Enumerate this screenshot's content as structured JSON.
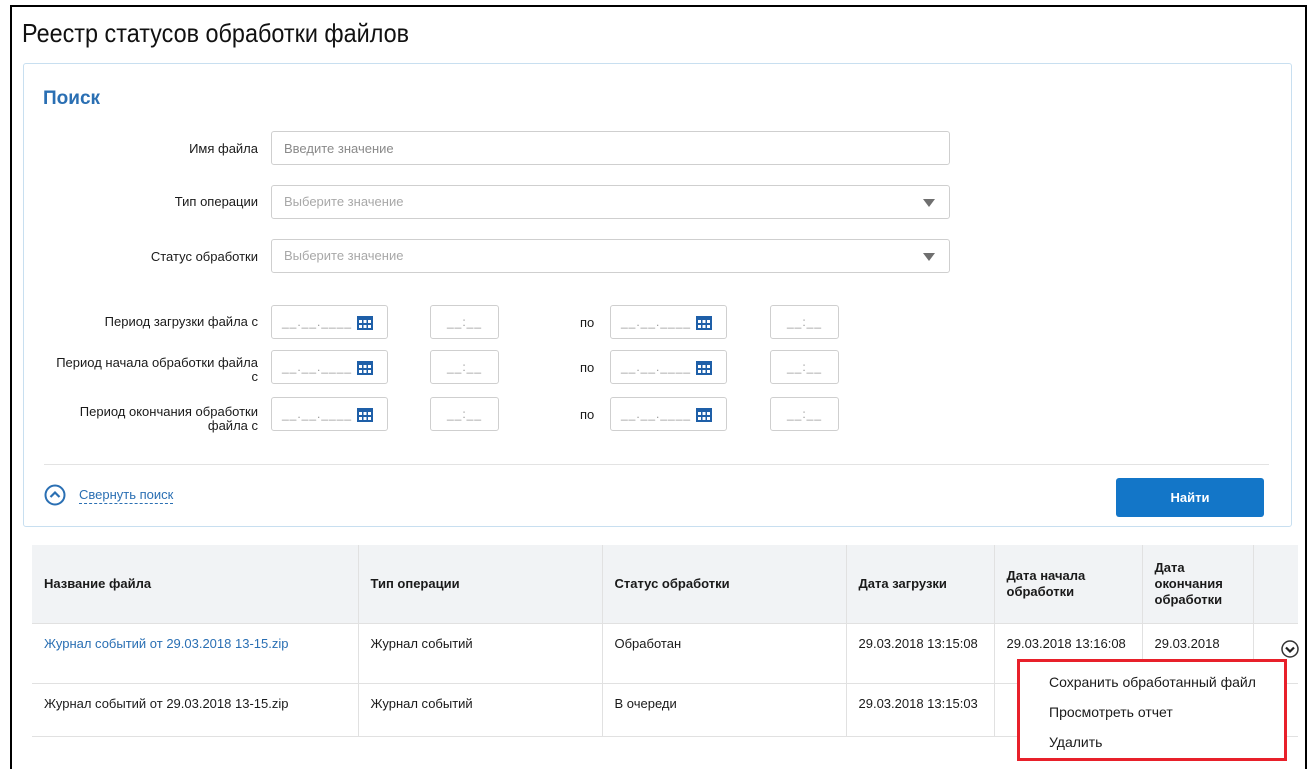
{
  "page": {
    "title": "Реестр статусов обработки файлов"
  },
  "search": {
    "title": "Поиск",
    "file_name": {
      "label": "Имя файла",
      "placeholder": "Введите значение",
      "value": ""
    },
    "operation_type": {
      "label": "Тип операции",
      "placeholder": "Выберите значение"
    },
    "processing_status": {
      "label": "Статус обработки",
      "placeholder": "Выберите значение"
    },
    "periods": [
      {
        "label_line1": "Период загрузки файла с",
        "label_line2": "",
        "date_from": "__.__.____",
        "time_from": "__:__",
        "to_label": "по",
        "date_to": "__.__.____",
        "time_to": "__:__"
      },
      {
        "label_line1": "Период начала обработки файла",
        "label_line2": "с",
        "date_from": "__.__.____",
        "time_from": "__:__",
        "to_label": "по",
        "date_to": "__.__.____",
        "time_to": "__:__"
      },
      {
        "label_line1": "Период окончания обработки",
        "label_line2": "файла с",
        "date_from": "__.__.____",
        "time_from": "__:__",
        "to_label": "по",
        "date_to": "__.__.____",
        "time_to": "__:__"
      }
    ],
    "collapse_label": "Свернуть поиск",
    "find_label": "Найти"
  },
  "table": {
    "headers": {
      "file_name": "Название файла",
      "operation_type": "Тип операции",
      "status": "Статус обработки",
      "upload_date": "Дата загрузки",
      "start_date_l1": "Дата начала",
      "start_date_l2": "обработки",
      "end_date_l1": "Дата",
      "end_date_l2": "окончания",
      "end_date_l3": "обработки"
    },
    "rows": [
      {
        "file_name": "Журнал событий от 29.03.2018 13-15.zip",
        "operation_type": "Журнал событий",
        "status": "Обработан",
        "upload_date": "29.03.2018 13:15:08",
        "start_date": "29.03.2018 13:16:08",
        "end_date": "29.03.2018"
      },
      {
        "file_name": "Журнал событий от 29.03.2018 13-15.zip",
        "operation_type": "Журнал событий",
        "status": "В очереди",
        "upload_date": "29.03.2018 13:15:03",
        "start_date": "",
        "end_date": ""
      }
    ]
  },
  "row_menu": {
    "icon": "chevron-down-circle-icon",
    "items": [
      "Сохранить обработанный файл",
      "Просмотреть отчет",
      "Удалить"
    ],
    "highlight_color": "#e8202a"
  },
  "colors": {
    "accent": "#1376c8",
    "link": "#2a6fb3",
    "panel_border": "#c8dff0"
  }
}
